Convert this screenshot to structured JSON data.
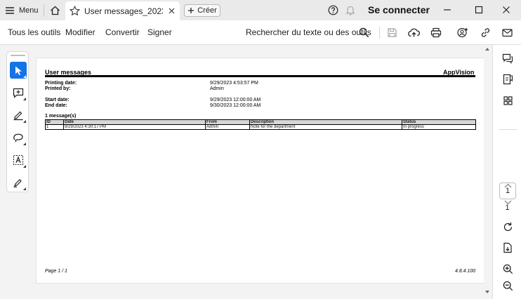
{
  "titlebar": {
    "menu_label": "Menu",
    "tab_title": "User messages_2023…",
    "create_label": "Créer",
    "connect_label": "Se connecter"
  },
  "toolbar": {
    "menu_items": [
      "Tous les outils",
      "Modifier",
      "Convertir",
      "Signer"
    ],
    "search_label": "Rechercher du texte ou des outils"
  },
  "report": {
    "title": "User messages",
    "brand": "AppVision",
    "printing_date_label": "Printing date:",
    "printing_date_value": "9/29/2023 4:53:57 PM",
    "printed_by_label": "Printed by:",
    "printed_by_value": "Admin",
    "start_date_label": "Start date:",
    "start_date_value": "9/29/2023 12:00:00 AM",
    "end_date_label": "End date:",
    "end_date_value": "9/30/2023 12:00:00 AM",
    "message_count": "1 message(s)",
    "table": {
      "headers": [
        "ID",
        "Date",
        "From",
        "Description",
        "Status"
      ],
      "rows": [
        [
          "1",
          "9/29/2023 4:30:17 PM",
          "Admin",
          "Note for the department",
          "In progress"
        ]
      ]
    },
    "footer_page": "Page 1 / 1",
    "footer_version": "4.8.4.100"
  },
  "right_panel": {
    "current_page": "1",
    "total_pages": "1"
  },
  "colors": {
    "accent": "#1473e6",
    "titlebar_bg": "#eaeaea",
    "page_bg": "#ffffff"
  },
  "icons": {
    "titlebar": [
      "hamburger-menu-icon",
      "home-icon",
      "star-icon",
      "close-icon",
      "plus-icon",
      "help-icon",
      "bell-icon",
      "minimize-icon",
      "maximize-icon",
      "window-close-icon"
    ],
    "toolbar": [
      "search-icon",
      "save-icon",
      "upload-icon",
      "print-icon",
      "add-user-icon",
      "link-icon",
      "mail-icon"
    ],
    "left_rail": [
      "select-cursor-icon",
      "add-comment-icon",
      "highlight-pen-icon",
      "lasso-icon",
      "text-select-icon",
      "sign-pen-icon"
    ],
    "right_panel": [
      "comments-icon",
      "bookmark-icon",
      "thumbnails-grid-icon",
      "chevron-up-icon",
      "chevron-down-icon",
      "rotate-icon",
      "extract-page-icon",
      "zoom-in-icon",
      "zoom-out-icon"
    ]
  }
}
